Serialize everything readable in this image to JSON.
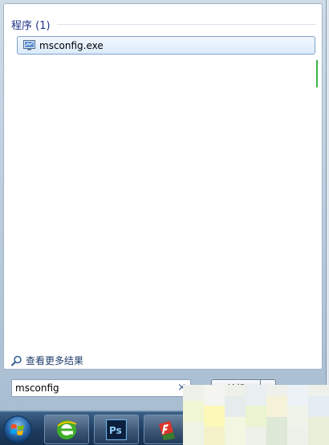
{
  "start_menu": {
    "group_title": "程序 (1)",
    "results": [
      {
        "label": "msconfig.exe",
        "icon": "msconfig-icon"
      }
    ],
    "see_more_label": "查看更多结果",
    "search": {
      "value": "msconfig",
      "clear_glyph": "×"
    },
    "shutdown_label": "关机"
  },
  "taskbar": {
    "items": [
      {
        "name": "start-orb",
        "icon": "windows-logo-icon"
      },
      {
        "name": "ie-browser",
        "icon": "browser-icon"
      },
      {
        "name": "photoshop",
        "icon": "photoshop-icon",
        "text": "Ps"
      },
      {
        "name": "flash-app",
        "icon": "flashget-icon"
      }
    ]
  },
  "colors": {
    "group_title": "#1e3287",
    "selection_border": "#7da2ce",
    "taskbar": "#1d3b5e"
  }
}
